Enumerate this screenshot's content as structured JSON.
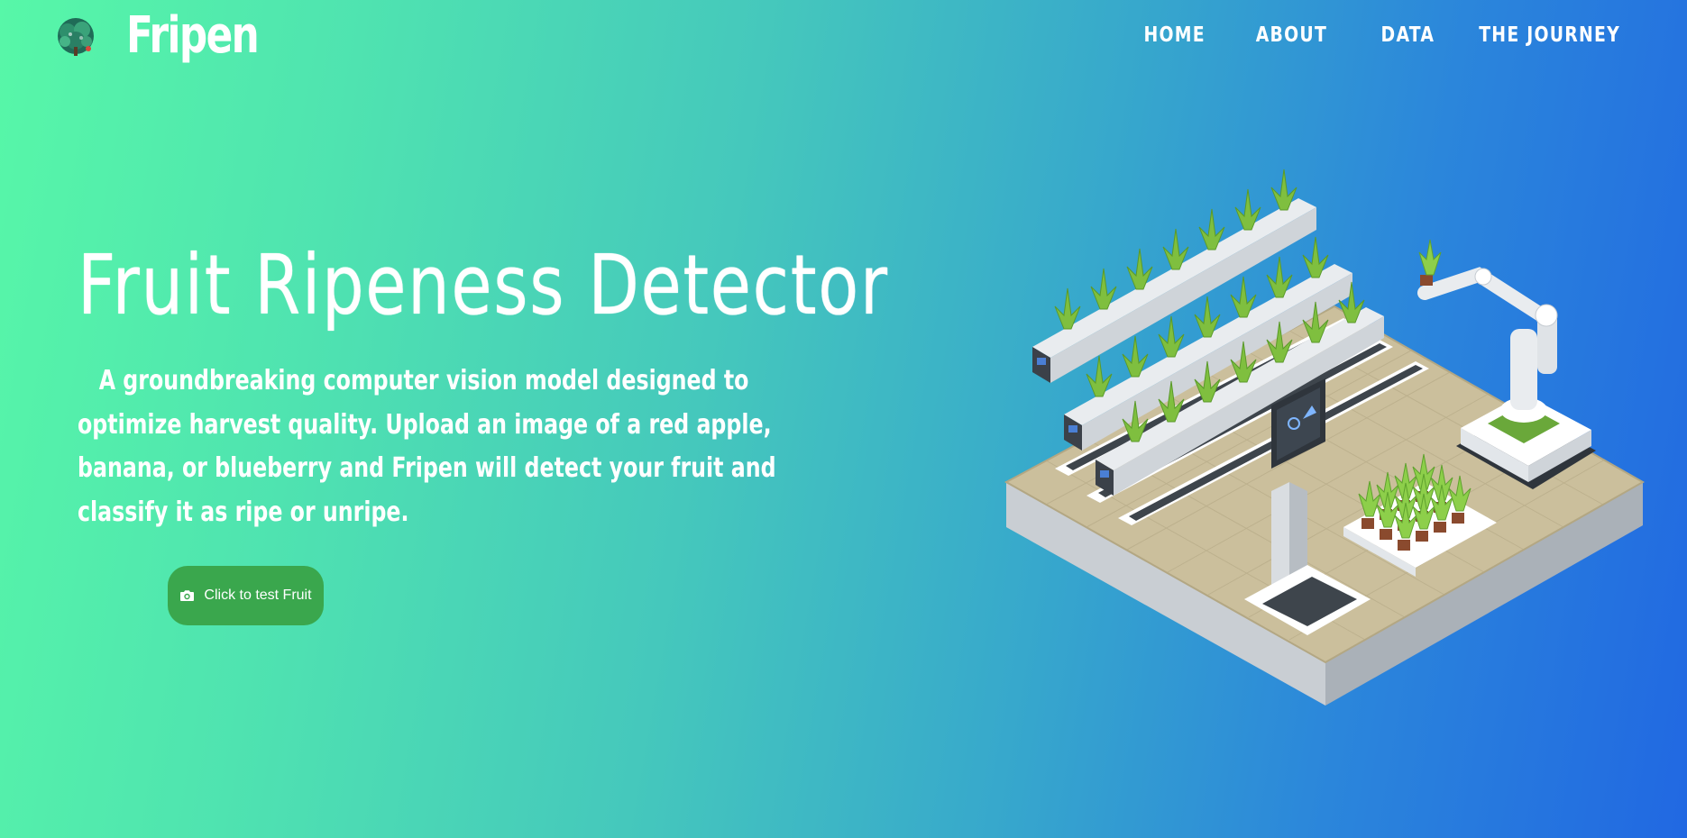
{
  "brand": {
    "name": "Fripen",
    "logo_icon": "tree-logo-icon"
  },
  "nav": {
    "items": [
      {
        "label": "HOME"
      },
      {
        "label": "ABOUT"
      },
      {
        "label": "DATA"
      },
      {
        "label": "THE JOURNEY"
      }
    ]
  },
  "hero": {
    "title": "Fruit Ripeness Detector",
    "description": "A groundbreaking computer vision model designed to optimize harvest quality. Upload an image of a red apple, banana, or blueberry and Fripen will detect your fruit and classify it as ripe or unripe.",
    "cta_label": "Click to test Fruit",
    "cta_icon": "camera-icon"
  },
  "colors": {
    "gradient_start": "#57f7a8",
    "gradient_end": "#2168e2",
    "button": "#3aa74d",
    "text": "#ffffff"
  }
}
